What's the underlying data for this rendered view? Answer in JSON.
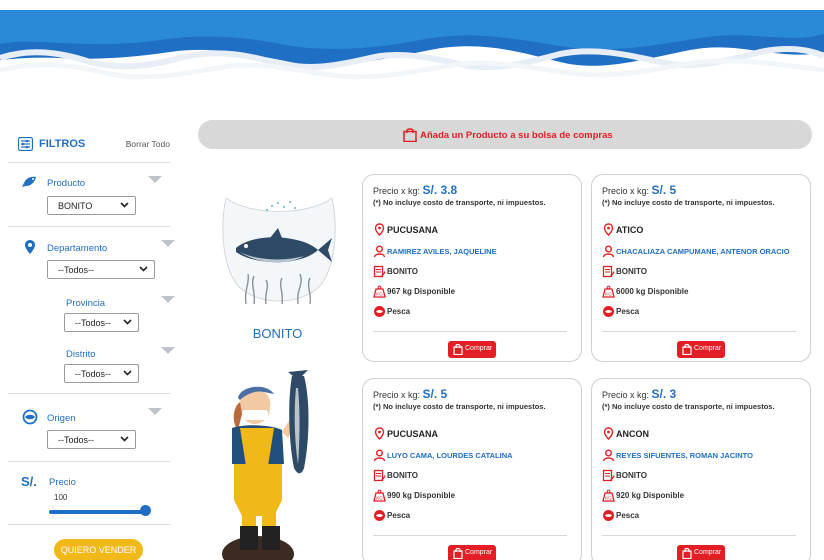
{
  "sidebar": {
    "filters_title": "FILTROS",
    "clear_all": "Borrar Todo",
    "producto": {
      "label": "Producto",
      "value": "BONITO"
    },
    "departamento": {
      "label": "Departamento",
      "value": "--Todos--"
    },
    "provincia": {
      "label": "Provincia",
      "value": "--Todos--"
    },
    "distrito": {
      "label": "Distrito",
      "value": "--Todos--"
    },
    "origen": {
      "label": "Origen",
      "value": "--Todos--"
    },
    "precio": {
      "symbol": "S/.",
      "label": "Precio",
      "value": "100"
    },
    "sell_button": "QUIERO VENDER"
  },
  "cart_banner": {
    "text": "Añada un Producto a su bolsa de compras",
    "icon": "shopping-bag-icon"
  },
  "product": {
    "name": "BONITO"
  },
  "colors": {
    "accent": "#1f6fc4",
    "cta": "#e31e24",
    "sell": "#f0b918"
  },
  "cards": [
    {
      "price_label": "Precio x kg:",
      "price": "S/. 3.8",
      "note": "(*) No incluye costo de transporte, ni impuestos.",
      "location": "PUCUSANA",
      "seller": "RAMIREZ AVILES, JAQUELINE",
      "product": "BONITO",
      "stock": "967 kg Disponible",
      "origin": "Pesca",
      "buy": "Comprar"
    },
    {
      "price_label": "Precio x kg:",
      "price": "S/. 5",
      "note": "(*) No incluye costo de transporte, ni impuestos.",
      "location": "ATICO",
      "seller": "CHACALIAZA CAMPUMANE, ANTENOR ORACIO",
      "product": "BONITO",
      "stock": "6000 kg Disponible",
      "origin": "Pesca",
      "buy": "Comprar"
    },
    {
      "price_label": "Precio x kg:",
      "price": "S/. 5",
      "note": "(*) No incluye costo de transporte, ni impuestos.",
      "location": "PUCUSANA",
      "seller": "LUYO CAMA, LOURDES CATALINA",
      "product": "BONITO",
      "stock": "990 kg Disponible",
      "origin": "Pesca",
      "buy": "Comprar"
    },
    {
      "price_label": "Precio x kg:",
      "price": "S/. 3",
      "note": "(*) No incluye costo de transporte, ni impuestos.",
      "location": "ANCON",
      "seller": "REYES SIFUENTES, ROMAN JACINTO",
      "product": "BONITO",
      "stock": "920 kg Disponible",
      "origin": "Pesca",
      "buy": "Comprar"
    }
  ]
}
